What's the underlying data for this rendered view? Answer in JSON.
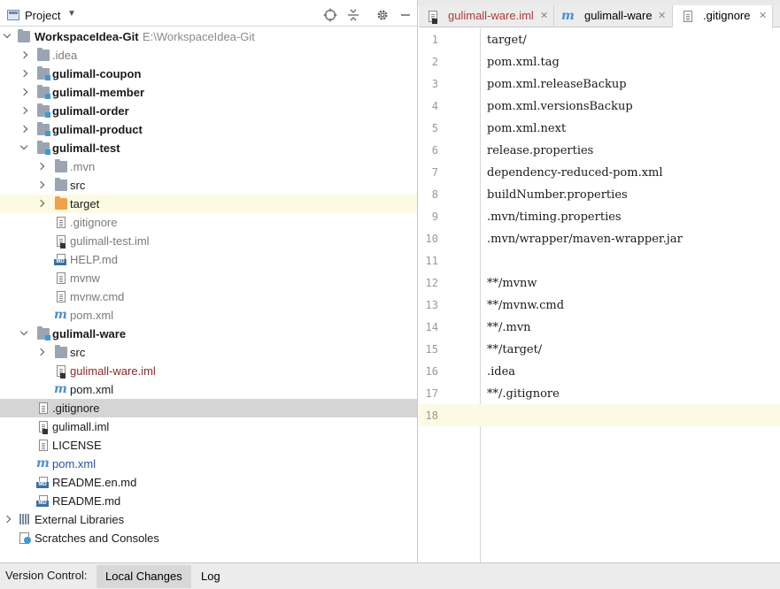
{
  "project_panel": {
    "title": "Project",
    "tree": [
      {
        "label": "WorkspaceIdea-Git",
        "path": "E:\\WorkspaceIdea-Git"
      },
      {
        "label": ".idea"
      },
      {
        "label": "gulimall-coupon"
      },
      {
        "label": "gulimall-member"
      },
      {
        "label": "gulimall-order"
      },
      {
        "label": "gulimall-product"
      },
      {
        "label": "gulimall-test"
      },
      {
        "label": ".mvn"
      },
      {
        "label": "src"
      },
      {
        "label": "target"
      },
      {
        "label": ".gitignore"
      },
      {
        "label": "gulimall-test.iml"
      },
      {
        "label": "HELP.md"
      },
      {
        "label": "mvnw"
      },
      {
        "label": "mvnw.cmd"
      },
      {
        "label": "pom.xml"
      },
      {
        "label": "gulimall-ware"
      },
      {
        "label": "src"
      },
      {
        "label": "gulimall-ware.iml"
      },
      {
        "label": "pom.xml"
      },
      {
        "label": ".gitignore"
      },
      {
        "label": "gulimall.iml"
      },
      {
        "label": "LICENSE"
      },
      {
        "label": "pom.xml"
      },
      {
        "label": "README.en.md"
      },
      {
        "label": "README.md"
      },
      {
        "label": "External Libraries"
      },
      {
        "label": "Scratches and Consoles"
      }
    ]
  },
  "editor": {
    "tabs": [
      {
        "label": "gulimall-ware.iml"
      },
      {
        "label": "gulimall-ware"
      },
      {
        "label": ".gitignore"
      }
    ],
    "line_numbers": [
      "1",
      "2",
      "3",
      "4",
      "5",
      "6",
      "7",
      "8",
      "9",
      "10",
      "11",
      "12",
      "13",
      "14",
      "15",
      "16",
      "17",
      "18"
    ],
    "lines": [
      "target/",
      "pom.xml.tag",
      "pom.xml.releaseBackup",
      "pom.xml.versionsBackup",
      "pom.xml.next",
      "release.properties",
      "dependency-reduced-pom.xml",
      "buildNumber.properties",
      ".mvn/timing.properties",
      ".mvn/wrapper/maven-wrapper.jar",
      "",
      "**/mvnw",
      "**/mvnw.cmd",
      "**/.mvn",
      "**/target/",
      ".idea",
      "**/.gitignore",
      ""
    ]
  },
  "bottom_bar": {
    "label": "Version Control:",
    "tabs": [
      {
        "label": "Local Changes"
      },
      {
        "label": "Log"
      }
    ]
  },
  "icons": {
    "project": "project-icon",
    "locate": "crosshair-icon",
    "collapse": "collapse-icon",
    "settings": "gear-icon",
    "hide": "minimize-icon",
    "tab_close": "close-icon"
  }
}
